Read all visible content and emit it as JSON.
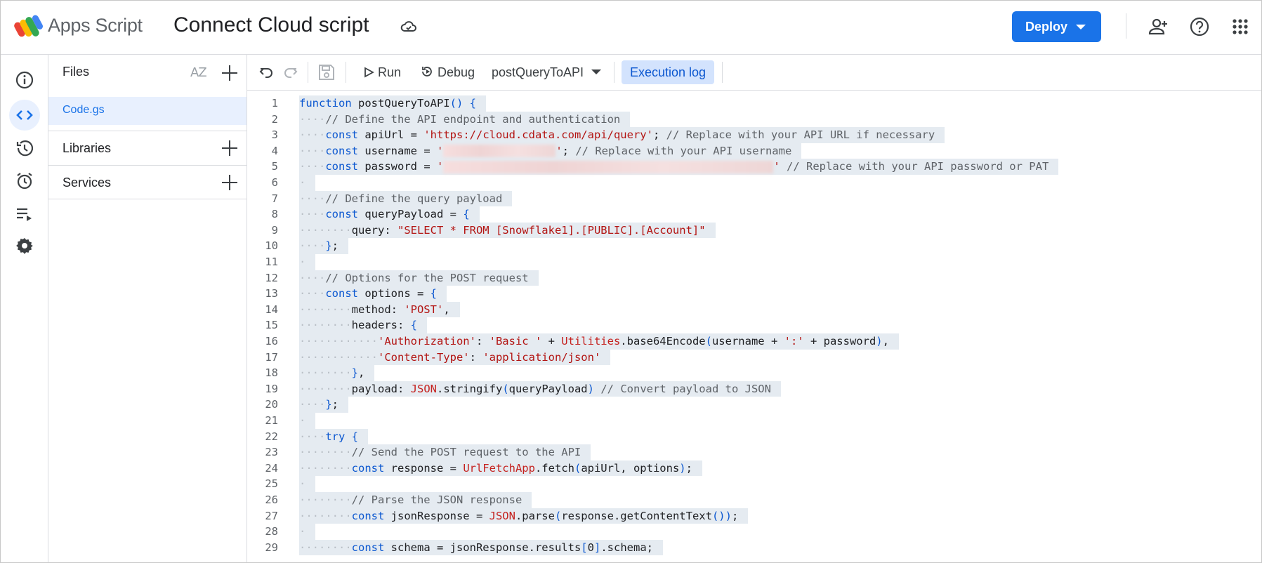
{
  "app": {
    "name": "Apps Script",
    "project_title": "Connect Cloud script"
  },
  "header": {
    "deploy_label": "Deploy"
  },
  "files_panel": {
    "title": "Files",
    "sort_label": "AZ",
    "files": [
      {
        "name": "Code.gs"
      }
    ],
    "libraries_label": "Libraries",
    "services_label": "Services"
  },
  "toolbar": {
    "run_label": "Run",
    "debug_label": "Debug",
    "function_selected": "postQueryToAPI",
    "execution_log_label": "Execution log"
  },
  "editor": {
    "lines": [
      {
        "n": "1",
        "tokens": [
          [
            "kw",
            "function"
          ],
          [
            "",
            "·postQueryToAPI"
          ],
          [
            "kw",
            "()"
          ],
          [
            "",
            "·"
          ],
          [
            "kw",
            "{"
          ]
        ]
      },
      {
        "n": "2",
        "tokens": [
          [
            "ws",
            "····"
          ],
          [
            "cm",
            "//·Define·the·API·endpoint·and·authentication"
          ]
        ]
      },
      {
        "n": "3",
        "tokens": [
          [
            "ws",
            "····"
          ],
          [
            "kw",
            "const"
          ],
          [
            "",
            "·apiUrl·=·"
          ],
          [
            "st",
            "'https://cloud.cdata.com/api/query'"
          ],
          [
            "",
            ";·"
          ],
          [
            "cm",
            "//·Replace·with·your·API·URL·if·necessary"
          ]
        ]
      },
      {
        "n": "4",
        "tokens": [
          [
            "ws",
            "····"
          ],
          [
            "kw",
            "const"
          ],
          [
            "",
            "·username·=·"
          ],
          [
            "st",
            "'"
          ],
          [
            "blur",
            "160"
          ],
          [
            "st",
            "'"
          ],
          [
            "",
            ";·"
          ],
          [
            "cm",
            "//·Replace·with·your·API·username"
          ]
        ]
      },
      {
        "n": "5",
        "tokens": [
          [
            "ws",
            "····"
          ],
          [
            "kw",
            "const"
          ],
          [
            "",
            "·password·=·"
          ],
          [
            "st",
            "'"
          ],
          [
            "blur",
            "470"
          ],
          [
            "st",
            "'"
          ],
          [
            "",
            "·"
          ],
          [
            "cm",
            "//·Replace·with·your·API·password·or·PAT"
          ]
        ]
      },
      {
        "n": "6",
        "tokens": [
          [
            "ws",
            "·"
          ]
        ]
      },
      {
        "n": "7",
        "tokens": [
          [
            "ws",
            "····"
          ],
          [
            "cm",
            "//·Define·the·query·payload"
          ]
        ]
      },
      {
        "n": "8",
        "tokens": [
          [
            "ws",
            "····"
          ],
          [
            "kw",
            "const"
          ],
          [
            "",
            "·queryPayload·=·"
          ],
          [
            "kw",
            "{"
          ]
        ]
      },
      {
        "n": "9",
        "tokens": [
          [
            "ws",
            "········"
          ],
          [
            "",
            "query:·"
          ],
          [
            "st",
            "\"SELECT·*·FROM·[Snowflake1].[PUBLIC].[Account]\""
          ]
        ]
      },
      {
        "n": "10",
        "tokens": [
          [
            "ws",
            "····"
          ],
          [
            "kw",
            "}"
          ],
          [
            "",
            ";"
          ]
        ]
      },
      {
        "n": "11",
        "tokens": [
          [
            "ws",
            "·"
          ]
        ]
      },
      {
        "n": "12",
        "tokens": [
          [
            "ws",
            "····"
          ],
          [
            "cm",
            "//·Options·for·the·POST·request"
          ]
        ]
      },
      {
        "n": "13",
        "tokens": [
          [
            "ws",
            "····"
          ],
          [
            "kw",
            "const"
          ],
          [
            "",
            "·options·=·"
          ],
          [
            "kw",
            "{"
          ]
        ]
      },
      {
        "n": "14",
        "tokens": [
          [
            "ws",
            "········"
          ],
          [
            "",
            "method:·"
          ],
          [
            "st",
            "'POST'"
          ],
          [
            "",
            ","
          ]
        ]
      },
      {
        "n": "15",
        "tokens": [
          [
            "ws",
            "········"
          ],
          [
            "",
            "headers:·"
          ],
          [
            "kw",
            "{"
          ]
        ]
      },
      {
        "n": "16",
        "tokens": [
          [
            "ws",
            "············"
          ],
          [
            "st",
            "'Authorization'"
          ],
          [
            "",
            ":·"
          ],
          [
            "st",
            "'Basic·'"
          ],
          [
            "",
            "·+·"
          ],
          [
            "obj",
            "Utilities"
          ],
          [
            "",
            ".base64Encode"
          ],
          [
            "kw",
            "("
          ],
          [
            "",
            "username·+·"
          ],
          [
            "st",
            "':'"
          ],
          [
            "",
            "·+·password"
          ],
          [
            "kw",
            ")"
          ],
          [
            "",
            ","
          ]
        ]
      },
      {
        "n": "17",
        "tokens": [
          [
            "ws",
            "············"
          ],
          [
            "st",
            "'Content-Type'"
          ],
          [
            "",
            ":·"
          ],
          [
            "st",
            "'application/json'"
          ]
        ]
      },
      {
        "n": "18",
        "tokens": [
          [
            "ws",
            "········"
          ],
          [
            "kw",
            "}"
          ],
          [
            "",
            ","
          ]
        ]
      },
      {
        "n": "19",
        "tokens": [
          [
            "ws",
            "········"
          ],
          [
            "",
            "payload:·"
          ],
          [
            "obj",
            "JSON"
          ],
          [
            "",
            ".stringify"
          ],
          [
            "kw",
            "("
          ],
          [
            "",
            "queryPayload"
          ],
          [
            "kw",
            ")"
          ],
          [
            "",
            "·"
          ],
          [
            "cm",
            "//·Convert·payload·to·JSON"
          ]
        ]
      },
      {
        "n": "20",
        "tokens": [
          [
            "ws",
            "····"
          ],
          [
            "kw",
            "}"
          ],
          [
            "",
            ";"
          ]
        ]
      },
      {
        "n": "21",
        "tokens": [
          [
            "ws",
            "·"
          ]
        ]
      },
      {
        "n": "22",
        "tokens": [
          [
            "ws",
            "····"
          ],
          [
            "kw",
            "try"
          ],
          [
            "",
            "·"
          ],
          [
            "kw",
            "{"
          ]
        ]
      },
      {
        "n": "23",
        "tokens": [
          [
            "ws",
            "········"
          ],
          [
            "cm",
            "//·Send·the·POST·request·to·the·API"
          ]
        ]
      },
      {
        "n": "24",
        "tokens": [
          [
            "ws",
            "········"
          ],
          [
            "kw",
            "const"
          ],
          [
            "",
            "·response·=·"
          ],
          [
            "obj",
            "UrlFetchApp"
          ],
          [
            "",
            ".fetch"
          ],
          [
            "kw",
            "("
          ],
          [
            "",
            "apiUrl,·options"
          ],
          [
            "kw",
            ")"
          ],
          [
            "",
            ";"
          ]
        ]
      },
      {
        "n": "25",
        "tokens": [
          [
            "ws",
            "·"
          ]
        ]
      },
      {
        "n": "26",
        "tokens": [
          [
            "ws",
            "········"
          ],
          [
            "cm",
            "//·Parse·the·JSON·response"
          ]
        ]
      },
      {
        "n": "27",
        "tokens": [
          [
            "ws",
            "········"
          ],
          [
            "kw",
            "const"
          ],
          [
            "",
            "·jsonResponse·=·"
          ],
          [
            "obj",
            "JSON"
          ],
          [
            "",
            ".parse"
          ],
          [
            "kw",
            "("
          ],
          [
            "",
            "response.getContentText"
          ],
          [
            "kw",
            "())"
          ],
          [
            "",
            ";"
          ]
        ]
      },
      {
        "n": "28",
        "tokens": [
          [
            "ws",
            "·"
          ]
        ]
      },
      {
        "n": "29",
        "tokens": [
          [
            "ws",
            "········"
          ],
          [
            "kw",
            "const"
          ],
          [
            "",
            "·schema·=·jsonResponse.results"
          ],
          [
            "kw",
            "["
          ],
          [
            "",
            "0"
          ],
          [
            "kw",
            "]"
          ],
          [
            "",
            ".schema;"
          ]
        ]
      }
    ]
  },
  "icons": {
    "rail": [
      "info-icon",
      "code-icon",
      "history-icon",
      "triggers-icon",
      "executions-icon",
      "settings-icon"
    ],
    "header": [
      "add-person-icon",
      "help-icon",
      "apps-grid-icon"
    ]
  },
  "colors": {
    "accent": "#1a73e8",
    "selected_bg": "#e8f0fe",
    "selection": "#e5ebf1"
  }
}
